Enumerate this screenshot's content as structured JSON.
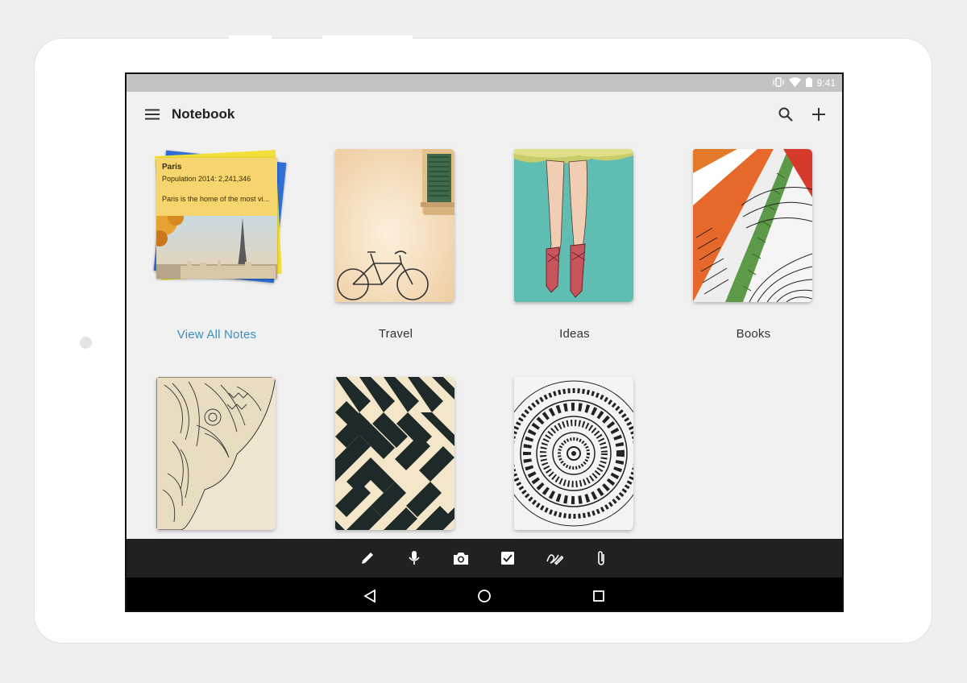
{
  "status": {
    "time": "9:41"
  },
  "appbar": {
    "title": "Notebook"
  },
  "icons": {
    "menu": "hamburger-menu-icon",
    "search": "search-icon",
    "add": "plus-icon"
  },
  "notebooks": [
    {
      "label": "View All Notes",
      "type": "all-notes"
    },
    {
      "label": "Travel",
      "type": "cover"
    },
    {
      "label": "Ideas",
      "type": "cover"
    },
    {
      "label": "Books",
      "type": "cover"
    },
    {
      "label": "",
      "type": "cover"
    },
    {
      "label": "",
      "type": "cover"
    },
    {
      "label": "",
      "type": "cover"
    }
  ],
  "note_preview": {
    "title": "Paris",
    "line1": "Population 2014: 2,241,346",
    "line2": "Paris is the home of the most vi..."
  },
  "toolbar": [
    "pencil-icon",
    "microphone-icon",
    "camera-icon",
    "checkbox-icon",
    "scribble-icon",
    "paperclip-icon"
  ],
  "navbar": [
    "back-icon",
    "home-icon",
    "recents-icon"
  ],
  "colors": {
    "accent": "#3a8fbf",
    "toolbar": "#212121",
    "navbar": "#000000",
    "background": "#f1f1f1"
  }
}
